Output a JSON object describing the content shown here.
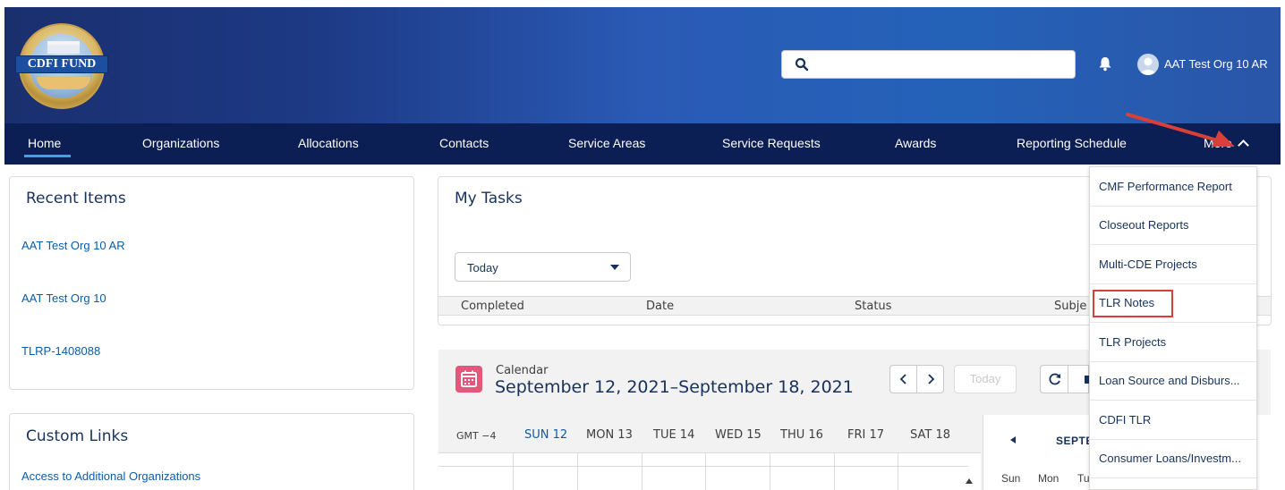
{
  "header": {
    "logo_text": "CDFI FUND",
    "search_placeholder": "",
    "user_name": "AAT Test Org 10 AR"
  },
  "nav": {
    "items": [
      "Home",
      "Organizations",
      "Allocations",
      "Contacts",
      "Service Areas",
      "Service Requests",
      "Awards",
      "Reporting Schedule"
    ],
    "more_label": "More",
    "active": "Home"
  },
  "more_menu": {
    "items": [
      "CMF Performance Report",
      "Closeout Reports",
      "Multi-CDE Projects",
      "TLR Notes",
      "TLR Projects",
      "Loan Source and Disburs...",
      "CDFI TLR",
      "Consumer Loans/Investm..."
    ],
    "highlighted": "TLR Notes"
  },
  "recent_items": {
    "title": "Recent Items",
    "links": [
      "AAT Test Org 10 AR",
      "AAT Test Org 10",
      "TLRP-1408088"
    ]
  },
  "custom_links": {
    "title": "Custom Links",
    "links": [
      "Access to Additional Organizations"
    ]
  },
  "tasks": {
    "title": "My Tasks",
    "filter_value": "Today",
    "columns": [
      "Completed",
      "Date",
      "Status",
      "Subje"
    ]
  },
  "calendar": {
    "label": "Calendar",
    "range": "September 12, 2021–September 18, 2021",
    "today_label": "Today",
    "timezone": "GMT −4",
    "days": [
      "SUN 12",
      "MON 13",
      "TUE 14",
      "WED 15",
      "THU 16",
      "FRI 17",
      "SAT 18"
    ],
    "mini_month": "SEPTE",
    "mini_weekdays": [
      "Sun",
      "Mon",
      "Tu"
    ]
  },
  "colors": {
    "nav_bg": "#0b1f55",
    "link": "#0b5cab",
    "active_day": "#0b5cab",
    "calendar_icon": "#e3577a",
    "annotation": "#d9403a"
  }
}
